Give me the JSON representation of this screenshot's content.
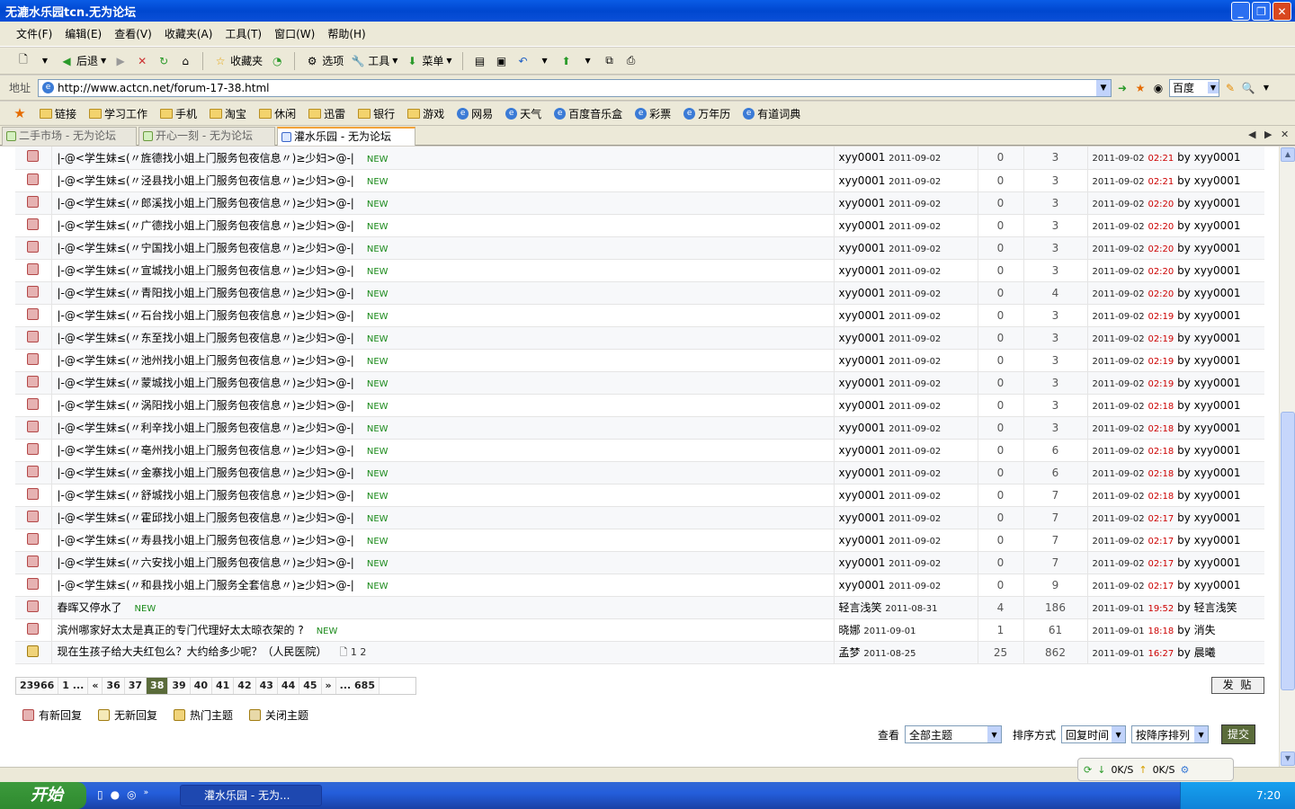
{
  "window": {
    "title": "无漉水乐园tcn.无为论坛"
  },
  "menu": [
    "文件(F)",
    "编辑(E)",
    "查看(V)",
    "收藏夹(A)",
    "工具(T)",
    "窗口(W)",
    "帮助(H)"
  ],
  "toolbar": {
    "back": "后退",
    "favorites": "收藏夹",
    "options": "选项",
    "tools": "工具",
    "menu": "菜单"
  },
  "address": {
    "label": "地址",
    "url": "http://www.actcn.net/forum-17-38.html",
    "search_engine": "百度"
  },
  "links": [
    "链接",
    "学习工作",
    "手机",
    "淘宝",
    "休闲",
    "迅雷",
    "银行",
    "游戏",
    "网易",
    "天气",
    "百度音乐盒",
    "彩票",
    "万年历",
    "有道词典"
  ],
  "tabs": [
    "二手市场 - 无为论坛",
    "开心一刻 - 无为论坛",
    "灌水乐园 - 无为论坛"
  ],
  "threads": [
    {
      "title": "|-@<学生妹≤(〃旌德找小姐上门服务包夜信息〃)≥少妇>@-|",
      "tag": "NEW",
      "author": "xyy0001",
      "date": "2011-09-02",
      "replies": "0",
      "views": "3",
      "last_date": "2011-09-02",
      "last_time": "02:21",
      "last_by": "by",
      "last_user": "xyy0001"
    },
    {
      "title": "|-@<学生妹≤(〃泾县找小姐上门服务包夜信息〃)≥少妇>@-|",
      "tag": "NEW",
      "author": "xyy0001",
      "date": "2011-09-02",
      "replies": "0",
      "views": "3",
      "last_date": "2011-09-02",
      "last_time": "02:21",
      "last_by": "by",
      "last_user": "xyy0001"
    },
    {
      "title": "|-@<学生妹≤(〃郎溪找小姐上门服务包夜信息〃)≥少妇>@-|",
      "tag": "NEW",
      "author": "xyy0001",
      "date": "2011-09-02",
      "replies": "0",
      "views": "3",
      "last_date": "2011-09-02",
      "last_time": "02:20",
      "last_by": "by",
      "last_user": "xyy0001"
    },
    {
      "title": "|-@<学生妹≤(〃广德找小姐上门服务包夜信息〃)≥少妇>@-|",
      "tag": "NEW",
      "author": "xyy0001",
      "date": "2011-09-02",
      "replies": "0",
      "views": "3",
      "last_date": "2011-09-02",
      "last_time": "02:20",
      "last_by": "by",
      "last_user": "xyy0001"
    },
    {
      "title": "|-@<学生妹≤(〃宁国找小姐上门服务包夜信息〃)≥少妇>@-|",
      "tag": "NEW",
      "author": "xyy0001",
      "date": "2011-09-02",
      "replies": "0",
      "views": "3",
      "last_date": "2011-09-02",
      "last_time": "02:20",
      "last_by": "by",
      "last_user": "xyy0001"
    },
    {
      "title": "|-@<学生妹≤(〃宣城找小姐上门服务包夜信息〃)≥少妇>@-|",
      "tag": "NEW",
      "author": "xyy0001",
      "date": "2011-09-02",
      "replies": "0",
      "views": "3",
      "last_date": "2011-09-02",
      "last_time": "02:20",
      "last_by": "by",
      "last_user": "xyy0001"
    },
    {
      "title": "|-@<学生妹≤(〃青阳找小姐上门服务包夜信息〃)≥少妇>@-|",
      "tag": "NEW",
      "author": "xyy0001",
      "date": "2011-09-02",
      "replies": "0",
      "views": "4",
      "last_date": "2011-09-02",
      "last_time": "02:20",
      "last_by": "by",
      "last_user": "xyy0001"
    },
    {
      "title": "|-@<学生妹≤(〃石台找小姐上门服务包夜信息〃)≥少妇>@-|",
      "tag": "NEW",
      "author": "xyy0001",
      "date": "2011-09-02",
      "replies": "0",
      "views": "3",
      "last_date": "2011-09-02",
      "last_time": "02:19",
      "last_by": "by",
      "last_user": "xyy0001"
    },
    {
      "title": "|-@<学生妹≤(〃东至找小姐上门服务包夜信息〃)≥少妇>@-|",
      "tag": "NEW",
      "author": "xyy0001",
      "date": "2011-09-02",
      "replies": "0",
      "views": "3",
      "last_date": "2011-09-02",
      "last_time": "02:19",
      "last_by": "by",
      "last_user": "xyy0001"
    },
    {
      "title": "|-@<学生妹≤(〃池州找小姐上门服务包夜信息〃)≥少妇>@-|",
      "tag": "NEW",
      "author": "xyy0001",
      "date": "2011-09-02",
      "replies": "0",
      "views": "3",
      "last_date": "2011-09-02",
      "last_time": "02:19",
      "last_by": "by",
      "last_user": "xyy0001"
    },
    {
      "title": "|-@<学生妹≤(〃蒙城找小姐上门服务包夜信息〃)≥少妇>@-|",
      "tag": "NEW",
      "author": "xyy0001",
      "date": "2011-09-02",
      "replies": "0",
      "views": "3",
      "last_date": "2011-09-02",
      "last_time": "02:19",
      "last_by": "by",
      "last_user": "xyy0001"
    },
    {
      "title": "|-@<学生妹≤(〃涡阳找小姐上门服务包夜信息〃)≥少妇>@-|",
      "tag": "NEW",
      "author": "xyy0001",
      "date": "2011-09-02",
      "replies": "0",
      "views": "3",
      "last_date": "2011-09-02",
      "last_time": "02:18",
      "last_by": "by",
      "last_user": "xyy0001"
    },
    {
      "title": "|-@<学生妹≤(〃利辛找小姐上门服务包夜信息〃)≥少妇>@-|",
      "tag": "NEW",
      "author": "xyy0001",
      "date": "2011-09-02",
      "replies": "0",
      "views": "3",
      "last_date": "2011-09-02",
      "last_time": "02:18",
      "last_by": "by",
      "last_user": "xyy0001"
    },
    {
      "title": "|-@<学生妹≤(〃亳州找小姐上门服务包夜信息〃)≥少妇>@-|",
      "tag": "NEW",
      "author": "xyy0001",
      "date": "2011-09-02",
      "replies": "0",
      "views": "6",
      "last_date": "2011-09-02",
      "last_time": "02:18",
      "last_by": "by",
      "last_user": "xyy0001"
    },
    {
      "title": "|-@<学生妹≤(〃金寨找小姐上门服务包夜信息〃)≥少妇>@-|",
      "tag": "NEW",
      "author": "xyy0001",
      "date": "2011-09-02",
      "replies": "0",
      "views": "6",
      "last_date": "2011-09-02",
      "last_time": "02:18",
      "last_by": "by",
      "last_user": "xyy0001"
    },
    {
      "title": "|-@<学生妹≤(〃舒城找小姐上门服务包夜信息〃)≥少妇>@-|",
      "tag": "NEW",
      "author": "xyy0001",
      "date": "2011-09-02",
      "replies": "0",
      "views": "7",
      "last_date": "2011-09-02",
      "last_time": "02:18",
      "last_by": "by",
      "last_user": "xyy0001"
    },
    {
      "title": "|-@<学生妹≤(〃霍邱找小姐上门服务包夜信息〃)≥少妇>@-|",
      "tag": "NEW",
      "author": "xyy0001",
      "date": "2011-09-02",
      "replies": "0",
      "views": "7",
      "last_date": "2011-09-02",
      "last_time": "02:17",
      "last_by": "by",
      "last_user": "xyy0001"
    },
    {
      "title": "|-@<学生妹≤(〃寿县找小姐上门服务包夜信息〃)≥少妇>@-|",
      "tag": "NEW",
      "author": "xyy0001",
      "date": "2011-09-02",
      "replies": "0",
      "views": "7",
      "last_date": "2011-09-02",
      "last_time": "02:17",
      "last_by": "by",
      "last_user": "xyy0001"
    },
    {
      "title": "|-@<学生妹≤(〃六安找小姐上门服务包夜信息〃)≥少妇>@-|",
      "tag": "NEW",
      "author": "xyy0001",
      "date": "2011-09-02",
      "replies": "0",
      "views": "7",
      "last_date": "2011-09-02",
      "last_time": "02:17",
      "last_by": "by",
      "last_user": "xyy0001"
    },
    {
      "title": "|-@<学生妹≤(〃和县找小姐上门服务全套信息〃)≥少妇>@-|",
      "tag": "NEW",
      "author": "xyy0001",
      "date": "2011-09-02",
      "replies": "0",
      "views": "9",
      "last_date": "2011-09-02",
      "last_time": "02:17",
      "last_by": "by",
      "last_user": "xyy0001"
    },
    {
      "title": "春晖又停水了",
      "tag": "NEW",
      "author": "轻言浅笑",
      "date": "2011-08-31",
      "replies": "4",
      "views": "186",
      "last_date": "2011-09-01",
      "last_time": "19:52",
      "last_by": "by",
      "last_user": "轻言浅笑"
    },
    {
      "title": "滨州哪家好太太是真正的专门代理好太太晾衣架的 ?",
      "tag": "NEW",
      "author": "晓娜",
      "date": "2011-09-01",
      "replies": "1",
      "views": "61",
      "last_date": "2011-09-01",
      "last_time": "18:18",
      "last_by": "by",
      "last_user": "消失"
    },
    {
      "title": "现在生孩子给大夫红包么？大约给多少呢？（人民医院）",
      "tag": "",
      "pages": "1 2",
      "author": "孟梦",
      "date": "2011-08-25",
      "replies": "25",
      "views": "862",
      "last_date": "2011-09-01",
      "last_time": "16:27",
      "last_by": "by",
      "last_user": "晨曦"
    }
  ],
  "pager": {
    "total": "23966",
    "first": "1 ...",
    "prev": "«",
    "pages": [
      "36",
      "37",
      "38",
      "39",
      "40",
      "41",
      "42",
      "43",
      "44",
      "45"
    ],
    "current": "38",
    "next": "»",
    "last": "... 685"
  },
  "new_post": "发 贴",
  "legend": [
    "有新回复",
    "无新回复",
    "热门主题",
    "关闭主题"
  ],
  "filters": {
    "view_label": "查看",
    "view_value": "全部主题",
    "sort_label": "排序方式",
    "sort_value": "回复时间",
    "order_value": "按降序排列",
    "submit": "提交"
  },
  "speed": {
    "down": "0K/S",
    "up": "0K/S"
  },
  "taskbar": {
    "start": "开始",
    "task": "灌水乐园 - 无为...",
    "clock": "7:20"
  }
}
